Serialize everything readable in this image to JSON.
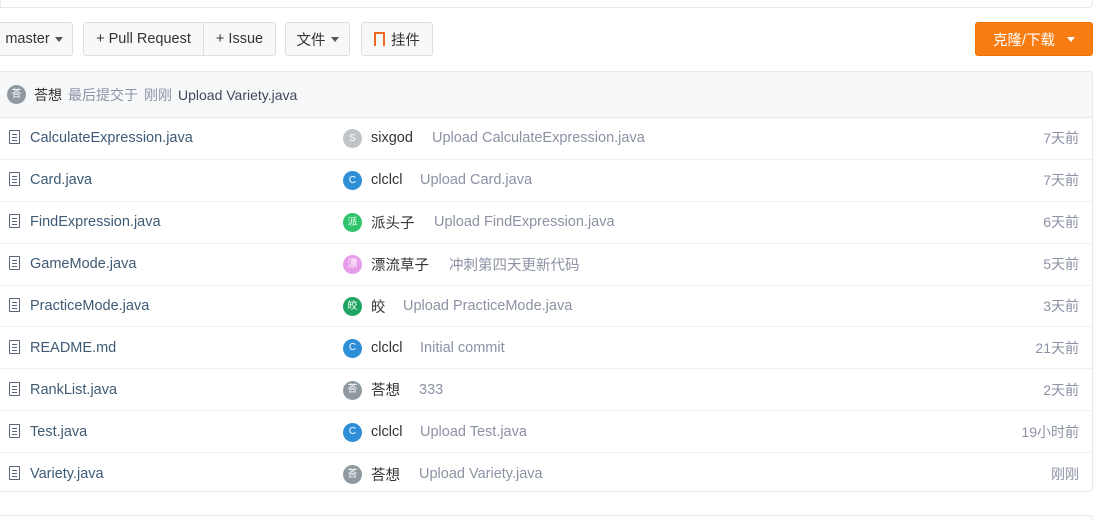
{
  "toolbar": {
    "branch_label": "master",
    "pull_request_label": "+ Pull Request",
    "issue_label": "+ Issue",
    "file_label": "文件",
    "widget_label": "挂件",
    "clone_label": "克隆/下载"
  },
  "colors": {
    "accent": "#f77c11",
    "link": "#3e5a75",
    "muted": "#8c92a4"
  },
  "last_commit": {
    "avatar_char": "荅",
    "author": "荅想",
    "label": "最后提交于",
    "time": "刚刚",
    "message": "Upload Variety.java"
  },
  "files": [
    {
      "name": "CalculateExpression.java",
      "avatar_char": "S",
      "avatar_color": "#bfc4c9",
      "committer": "sixgod",
      "message": "Upload CalculateExpression.java",
      "time": "7天前"
    },
    {
      "name": "Card.java",
      "avatar_char": "C",
      "avatar_color": "#2e8fd6",
      "committer": "clclcl",
      "message": "Upload Card.java",
      "time": "7天前"
    },
    {
      "name": "FindExpression.java",
      "avatar_char": "派",
      "avatar_color": "#2fc46b",
      "committer": "派头子",
      "message": "Upload FindExpression.java",
      "time": "6天前"
    },
    {
      "name": "GameMode.java",
      "avatar_char": "漂",
      "avatar_color": "#e79be8",
      "committer": "漂流草子",
      "message": "冲刺第四天更新代码",
      "time": "5天前"
    },
    {
      "name": "PracticeMode.java",
      "avatar_char": "皎",
      "avatar_color": "#1fa463",
      "committer": "皎",
      "message": "Upload PracticeMode.java",
      "time": "3天前"
    },
    {
      "name": "README.md",
      "avatar_char": "C",
      "avatar_color": "#2e8fd6",
      "committer": "clclcl",
      "message": "Initial commit",
      "time": "21天前"
    },
    {
      "name": "RankList.java",
      "avatar_char": "荅",
      "avatar_color": "#8f9aa0",
      "committer": "荅想",
      "message": "333",
      "time": "2天前"
    },
    {
      "name": "Test.java",
      "avatar_char": "C",
      "avatar_color": "#2e8fd6",
      "committer": "clclcl",
      "message": "Upload Test.java",
      "time": "19小时前"
    },
    {
      "name": "Variety.java",
      "avatar_char": "荅",
      "avatar_color": "#8f9aa0",
      "committer": "荅想",
      "message": "Upload Variety.java",
      "time": "刚刚"
    }
  ]
}
